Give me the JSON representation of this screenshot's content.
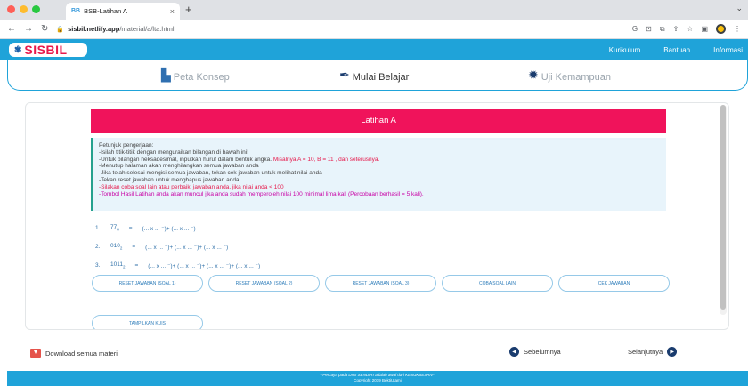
{
  "browser": {
    "tab_favicon": "BB",
    "tab_title": "BSB-Latihan A",
    "tab_close": "×",
    "new_tab": "+",
    "tab_menu": "⌄",
    "url_domain": "sisbil.netlify.app",
    "url_path": "/material/a/lta.html"
  },
  "site": {
    "logo_text": "SISBIL",
    "nav": [
      "Kurikulum",
      "Bantuan",
      "Informasi"
    ]
  },
  "modes": {
    "peta": "Peta Konsep",
    "belajar": "Mulai Belajar",
    "uji": "Uji Kemampuan"
  },
  "page": {
    "banner_title": "Latihan A",
    "instructions": {
      "heading": "Petunjuk pengerjaan:",
      "l1": "-Isilah titik-titik dengan menguraikan bilangan di bawah ini!",
      "l2a": "-Untuk bilangan heksadesimal, inputkan huruf dalam bentuk angka. ",
      "l2b": "Misalnya A = 10, B = 11 , dan seterusnya.",
      "l3": "-Menutup halaman akan menghilangkan semua jawaban anda",
      "l4": "-Jika telah selesai mengisi semua jawaban, tekan cek jawaban untuk melihat nilai anda",
      "l5": "-Tekan reset jawaban untuk menghapus jawaban anda",
      "l6": "-Silakan coba soal lain atau perbaiki jawaban anda, jika nilai anda < 100",
      "l7": "-Tombol Hasil Latihan anda akan muncul jika anda sudah memperoleh nilai 100 minimal lima kali (Percobaan berhasil = 5 kali)."
    },
    "questions": [
      {
        "num": "1.",
        "base": "77",
        "sub": "8",
        "expr": "(... x ... ⁻)+ (... x ... ⁻)"
      },
      {
        "num": "2.",
        "base": "010",
        "sub": "2",
        "expr": "(... x ... ⁻)+ (... x ... ⁻)+ (... x ... ⁻)"
      },
      {
        "num": "3.",
        "base": "1011",
        "sub": "2",
        "expr": "(... x ... ⁻)+ (... x ... ⁻)+ (... x ... ⁻)+ (... x ... ⁻)"
      }
    ],
    "equals": "=",
    "buttons": {
      "reset1": "Reset Jawaban (Soal 1)",
      "reset2": "Reset Jawaban (Soal 2)",
      "reset3": "Reset Jawaban (Soal 3)",
      "coba": "Coba Soal Lain",
      "cek": "Cek Jawaban",
      "kuis": "Tampilkan Kuis"
    }
  },
  "footer_nav": {
    "download": "Download semua materi",
    "prev": "Sebelumnya",
    "next": "Selanjutnya"
  },
  "footer": {
    "tagline": "--Percaya pada DIRI SENDIRI adalah awal dari KESUKSESAN--",
    "copyright": "Copyright 2019 BektiUtami"
  },
  "colors": {
    "brand_blue": "#1fa3d9",
    "banner_pink": "#f0135b",
    "logo_red": "#e8194b"
  }
}
